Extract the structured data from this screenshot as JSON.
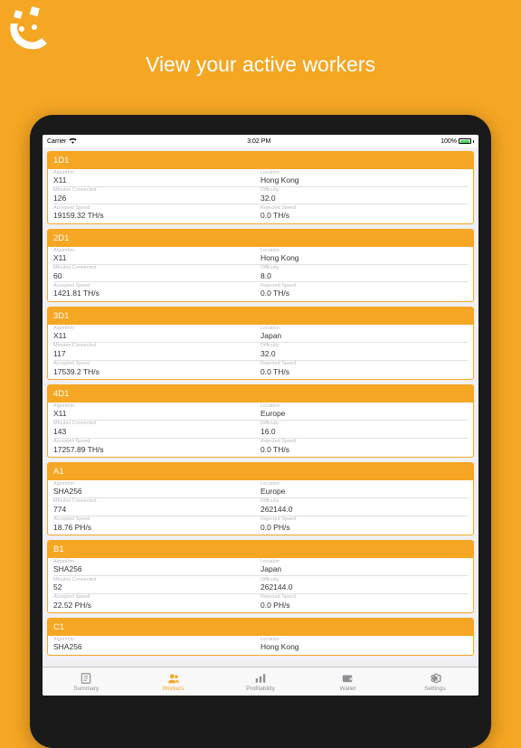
{
  "headline": "View your active workers",
  "statusbar": {
    "carrier": "Carrier",
    "time": "3:02 PM",
    "battery": "100%"
  },
  "labels": {
    "algorithm": "Algorithm",
    "location": "Location",
    "minutes": "Minutes Connected",
    "difficulty": "Difficulty",
    "accepted": "Accepted Speed",
    "rejected": "Rejected Speed"
  },
  "workers": [
    {
      "name": "1D1",
      "algorithm": "X11",
      "location": "Hong Kong",
      "minutes": "126",
      "difficulty": "32.0",
      "accepted": "19159.32 TH/s",
      "rejected": "0.0 TH/s"
    },
    {
      "name": "2D1",
      "algorithm": "X11",
      "location": "Hong Kong",
      "minutes": "60",
      "difficulty": "8.0",
      "accepted": "1421.81 TH/s",
      "rejected": "0.0 TH/s"
    },
    {
      "name": "3D1",
      "algorithm": "X11",
      "location": "Japan",
      "minutes": "117",
      "difficulty": "32.0",
      "accepted": "17539.2 TH/s",
      "rejected": "0.0 TH/s"
    },
    {
      "name": "4D1",
      "algorithm": "X11",
      "location": "Europe",
      "minutes": "143",
      "difficulty": "16.0",
      "accepted": "17257.89 TH/s",
      "rejected": "0.0 TH/s"
    },
    {
      "name": "A1",
      "algorithm": "SHA256",
      "location": "Europe",
      "minutes": "774",
      "difficulty": "262144.0",
      "accepted": "18.76 PH/s",
      "rejected": "0.0 PH/s"
    },
    {
      "name": "B1",
      "algorithm": "SHA256",
      "location": "Japan",
      "minutes": "52",
      "difficulty": "262144.0",
      "accepted": "22.52 PH/s",
      "rejected": "0.0 PH/s"
    },
    {
      "name": "C1",
      "algorithm": "SHA256",
      "location": "Hong Kong"
    }
  ],
  "tabs": [
    {
      "label": "Summary",
      "icon": "summary"
    },
    {
      "label": "Workers",
      "icon": "workers",
      "active": true
    },
    {
      "label": "Profitability",
      "icon": "profitability"
    },
    {
      "label": "Wallet",
      "icon": "wallet"
    },
    {
      "label": "Settings",
      "icon": "settings"
    }
  ]
}
